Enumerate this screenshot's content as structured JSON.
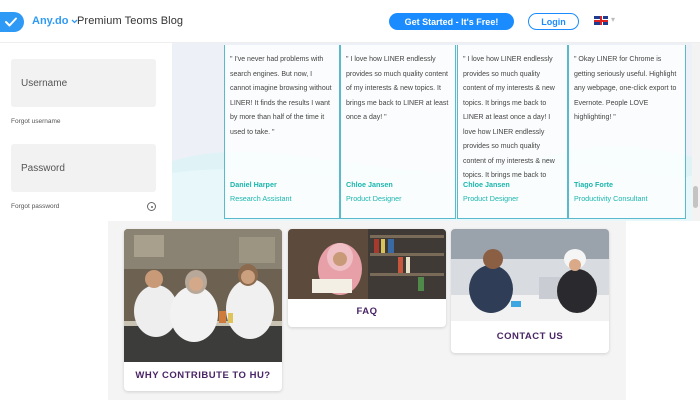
{
  "header": {
    "brand": "Any.do",
    "brand_suffix": "Premium Teoms Blog",
    "get_started": "Get Started - It's Free!",
    "login": "Login",
    "language_icon": "uk-flag-icon",
    "accent": "#1a8cff"
  },
  "signin": {
    "username_placeholder": "Username",
    "forgot_username": "Forgot username",
    "password_placeholder": "Password",
    "forgot_password": "Forgot password"
  },
  "testimonials": [
    {
      "quote": "\" I've never had problems with search engines. But now, I cannot imagine browsing without LINER! It finds the results I want by more than half of the time it used to take. \"",
      "name": "Daniel Harper",
      "role": "Research Assistant"
    },
    {
      "quote": "\" I love how LINER endlessly provides so much quality content of my interests & new topics. It brings me back to LINER at least once a day! \"",
      "name": "Chloe Jansen",
      "role": "Product Designer"
    },
    {
      "quote": "\" I love how LINER endlessly provides so much quality content of my interests & new topics. It brings me back to LINER at least once a day! I love how LINER endlessly provides so much quality content of my interests & new topics. It brings me back to LINER",
      "name": "Chloe Jansen",
      "role": "Product Designer"
    },
    {
      "quote": "\" Okay LINER for Chrome is getting seriously useful. Highlight any webpage, one-click export to Evernote. People LOVE highlighting! \"",
      "name": "Tiago Forte",
      "role": "Productivity Consultant"
    }
  ],
  "links": {
    "contribute": "WHY CONTRIBUTE TO HU?",
    "faq": "FAQ",
    "contact": "CONTACT US"
  }
}
